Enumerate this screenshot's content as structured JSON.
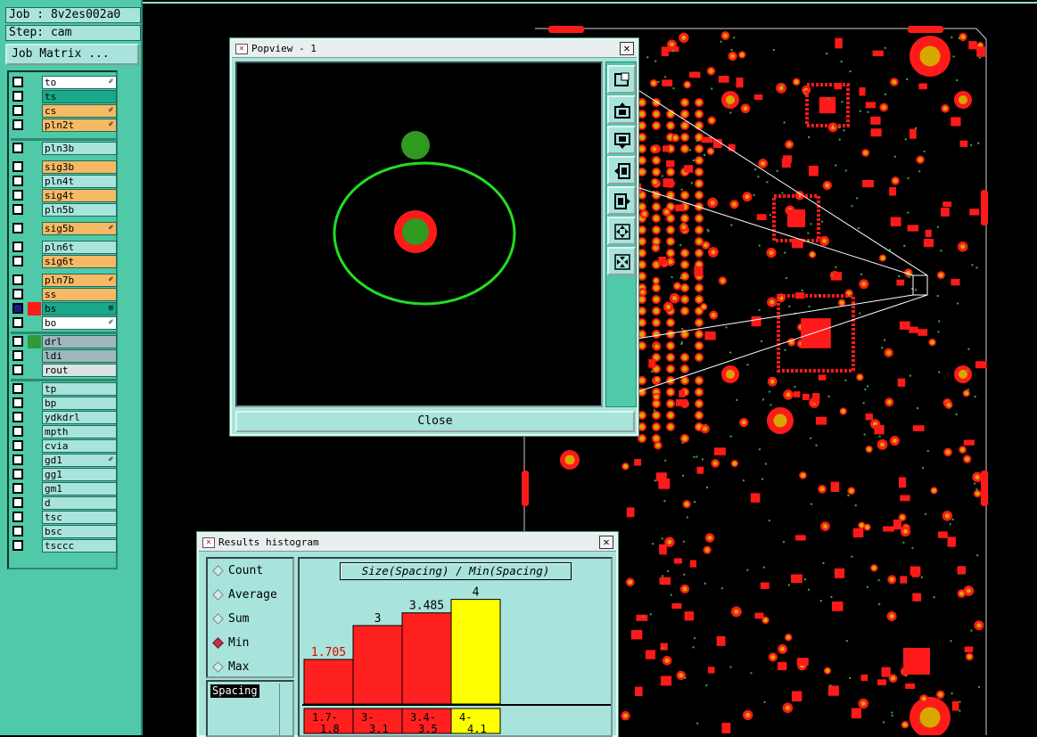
{
  "job": {
    "label": "Job : 8v2es002a0",
    "step": "Step: cam",
    "matrix_button": "Job Matrix ..."
  },
  "layers": [
    {
      "name": "to",
      "color": "white",
      "mark": "✐"
    },
    {
      "name": "ts",
      "color": "teal",
      "mark": ""
    },
    {
      "name": "cs",
      "color": "orange",
      "mark": "✐"
    },
    {
      "name": "pln2t",
      "color": "orange",
      "mark": "✐"
    },
    {
      "name": "pln3b",
      "color": "cyan",
      "mark": ""
    },
    {
      "name": "sig3b",
      "color": "orange",
      "mark": ""
    },
    {
      "name": "pln4t",
      "color": "cyan",
      "mark": ""
    },
    {
      "name": "sig4t",
      "color": "orange",
      "mark": ""
    },
    {
      "name": "pln5b",
      "color": "cyan",
      "mark": ""
    },
    {
      "name": "sig5b",
      "color": "orange",
      "mark": "✐"
    },
    {
      "name": "pln6t",
      "color": "cyan",
      "mark": ""
    },
    {
      "name": "sig6t",
      "color": "orange",
      "mark": ""
    },
    {
      "name": "pln7b",
      "color": "orange",
      "mark": "✐"
    },
    {
      "name": "ss",
      "color": "orange",
      "mark": ""
    },
    {
      "name": "bs",
      "color": "teal",
      "mark": "⊞",
      "active": true
    },
    {
      "name": "bo",
      "color": "white",
      "mark": "✐"
    },
    {
      "name": "drl",
      "color": "gray",
      "mark": "",
      "swatch": "#2f9a3a"
    },
    {
      "name": "ldi",
      "color": "gray",
      "mark": ""
    },
    {
      "name": "rout",
      "color": "light",
      "mark": ""
    },
    {
      "name": "tp",
      "color": "cyan",
      "mark": ""
    },
    {
      "name": "bp",
      "color": "cyan",
      "mark": ""
    },
    {
      "name": "ydkdrl",
      "color": "cyan",
      "mark": ""
    },
    {
      "name": "mpth",
      "color": "cyan",
      "mark": ""
    },
    {
      "name": "cvia",
      "color": "cyan",
      "mark": ""
    },
    {
      "name": "gd1",
      "color": "cyan",
      "mark": "✐"
    },
    {
      "name": "gg1",
      "color": "cyan",
      "mark": ""
    },
    {
      "name": "gm1",
      "color": "cyan",
      "mark": ""
    },
    {
      "name": "d",
      "color": "cyan",
      "mark": ""
    },
    {
      "name": "tsc",
      "color": "cyan",
      "mark": ""
    },
    {
      "name": "bsc",
      "color": "cyan",
      "mark": ""
    },
    {
      "name": "tsccc",
      "color": "cyan",
      "mark": ""
    }
  ],
  "popview": {
    "title": "Popview - 1",
    "close_x": "✕",
    "close_label": "Close"
  },
  "histogram": {
    "title": "Results histogram",
    "close_x": "✕",
    "options": [
      "Count",
      "Average",
      "Sum",
      "Min",
      "Max"
    ],
    "selected": "Min",
    "list_item": "Spacing",
    "plot_title": "Size(Spacing) / Min(Spacing)"
  },
  "chart_data": {
    "type": "bar",
    "title": "Size(Spacing) / Min(Spacing)",
    "categories": [
      "1.7-1.8",
      "3-3.1",
      "3.4-3.5",
      "4-4.1"
    ],
    "category_lines": [
      [
        "1.7-",
        "1.8"
      ],
      [
        "3-",
        "3.1"
      ],
      [
        "3.4-",
        "3.5"
      ],
      [
        "4-",
        "4.1"
      ]
    ],
    "values": [
      1.705,
      3,
      3.485,
      4
    ],
    "value_labels": [
      "1.705",
      "3",
      "3.485",
      "4"
    ],
    "bar_colors": [
      "#ff2020",
      "#ff2020",
      "#ff2020",
      "#ffff00"
    ],
    "label_colors": [
      "#e00000",
      "#000000",
      "#000000",
      "#000000"
    ],
    "ylim": [
      0,
      4.6
    ],
    "xlabel": "",
    "ylabel": "",
    "grid": false
  }
}
